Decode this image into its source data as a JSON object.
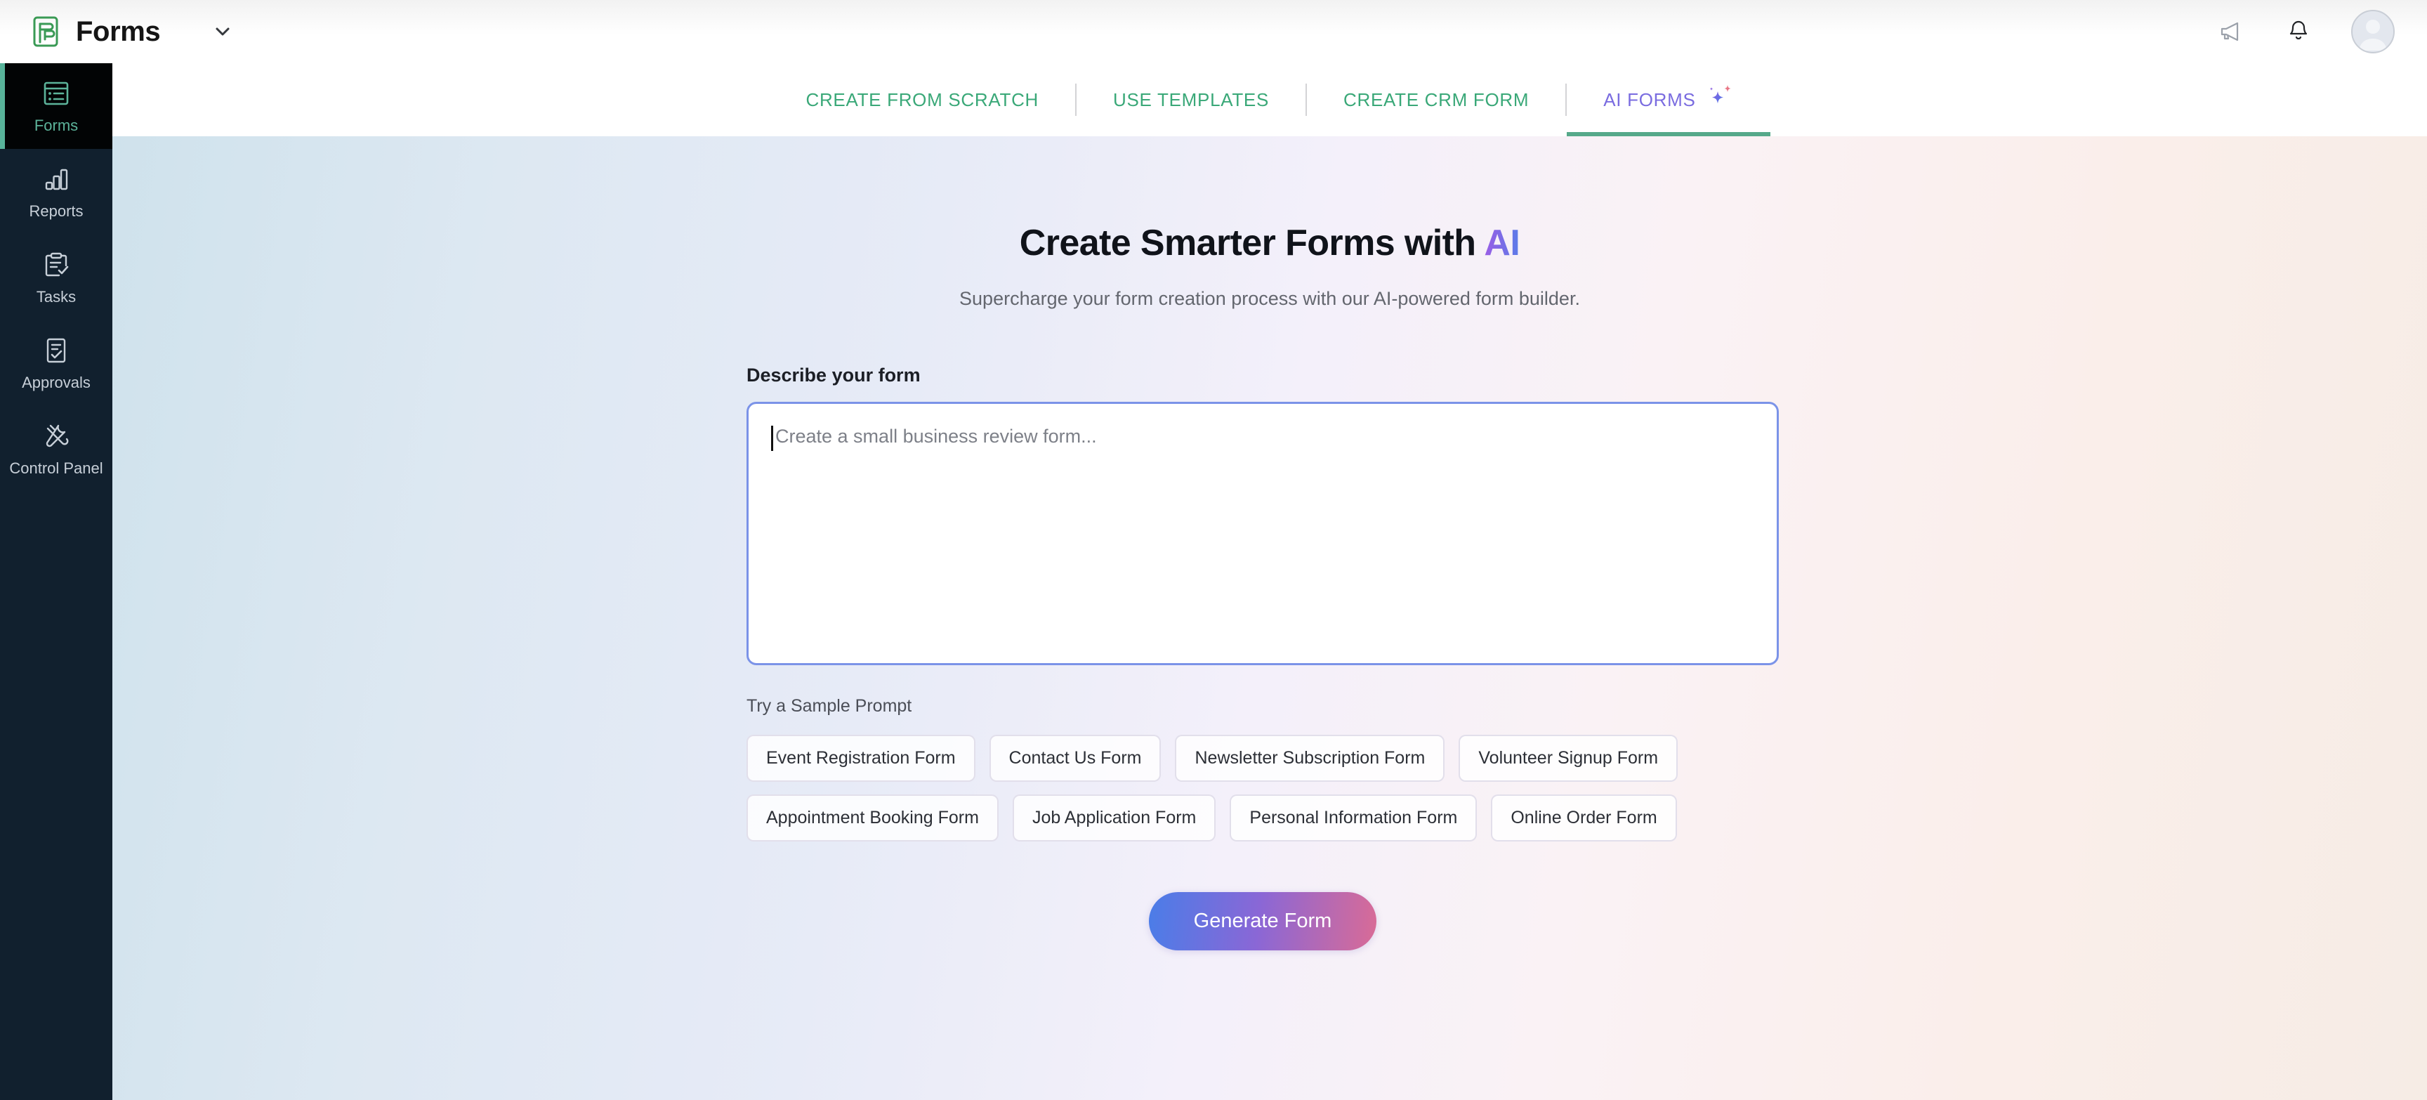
{
  "header": {
    "brand_name": "Forms",
    "logo_icon": "forms-logo-icon",
    "caret_icon": "chevron-down-icon",
    "announcement_icon": "megaphone-icon",
    "notification_icon": "bell-icon",
    "avatar_icon": "user-avatar"
  },
  "sidebar": {
    "items": [
      {
        "label": "Forms",
        "icon": "forms-icon",
        "active": true
      },
      {
        "label": "Reports",
        "icon": "bar-chart-icon",
        "active": false
      },
      {
        "label": "Tasks",
        "icon": "clipboard-check-icon",
        "active": false
      },
      {
        "label": "Approvals",
        "icon": "document-check-icon",
        "active": false
      },
      {
        "label": "Control Panel",
        "icon": "tools-icon",
        "active": false
      }
    ]
  },
  "tabs": [
    {
      "label": "CREATE FROM SCRATCH",
      "active": false
    },
    {
      "label": "USE TEMPLATES",
      "active": false
    },
    {
      "label": "CREATE CRM FORM",
      "active": false
    },
    {
      "label": "AI FORMS",
      "active": true,
      "icon": "sparkle-icon"
    }
  ],
  "main": {
    "title_prefix": "Create Smarter Forms with ",
    "title_highlight": "AI",
    "subtitle": "Supercharge your form creation process with our AI-powered form builder.",
    "field_label": "Describe your form",
    "prompt_value": "",
    "prompt_placeholder": "Create a small business review form...",
    "sample_label": "Try a Sample Prompt",
    "sample_prompts": [
      "Event Registration Form",
      "Contact Us Form",
      "Newsletter Subscription Form",
      "Volunteer Signup Form",
      "Appointment Booking Form",
      "Job Application Form",
      "Personal Information Form",
      "Online Order Form"
    ],
    "generate_label": "Generate Form"
  },
  "colors": {
    "brand_green": "#3aa878",
    "active_tab_purple": "#7a6ce0",
    "sidebar_bg": "#11202e",
    "sidebar_accent": "#58b39a",
    "input_border": "#7b93e8",
    "button_gradient_start": "#4a7de8",
    "button_gradient_mid": "#8a67d6",
    "button_gradient_end": "#d96b96"
  }
}
